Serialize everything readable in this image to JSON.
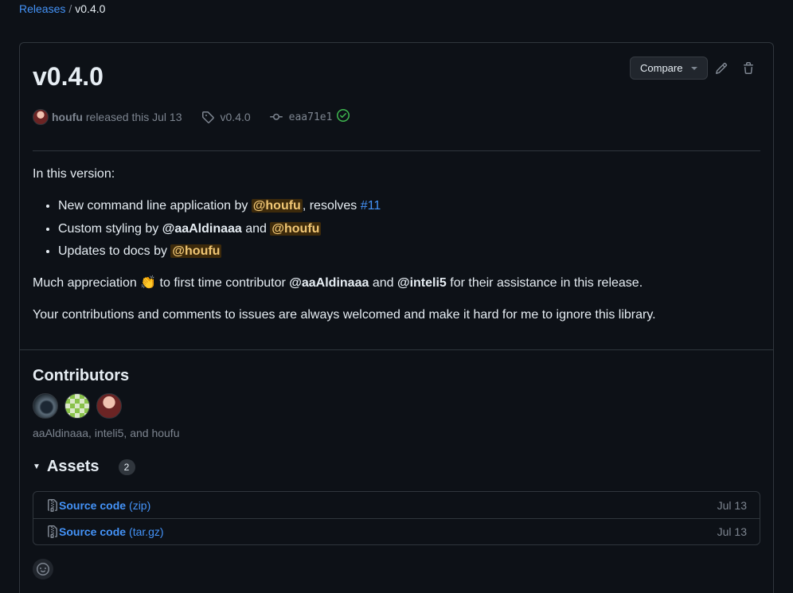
{
  "breadcrumb": {
    "root": "Releases",
    "separator": "/",
    "current": "v0.4.0"
  },
  "release": {
    "title": "v0.4.0",
    "compare_label": "Compare",
    "author": "houfu",
    "released_text": "released this Jul 13",
    "tag": "v0.4.0",
    "commit": "eaa71e1"
  },
  "notes": {
    "intro": "In this version:",
    "items": [
      {
        "text": "New command line application by ",
        "mention": "@houfu",
        "mid": ", resolves ",
        "issue": "#11"
      },
      {
        "text": "Custom styling by ",
        "mention": "@aaAldinaaa",
        "mid": " and ",
        "mention2": "@houfu"
      },
      {
        "text": "Updates to docs by ",
        "mention": "@houfu"
      }
    ],
    "appreciation": {
      "lead": "Much appreciation ",
      "emoji": "👏",
      "mid": " to first time contributor ",
      "m1": "@aaAldinaaa",
      "and": " and ",
      "m2": "@inteli5",
      "tail": " for their assistance in this release."
    },
    "closing": "Your contributions and comments to issues are always welcomed and make it hard for me to ignore this library."
  },
  "contributors": {
    "title": "Contributors",
    "names": "aaAldinaaa, inteli5, and houfu"
  },
  "assets": {
    "title": "Assets",
    "count": "2",
    "items": [
      {
        "name": "Source code",
        "ext": "(zip)",
        "date": "Jul 13"
      },
      {
        "name": "Source code",
        "ext": "(tar.gz)",
        "date": "Jul 13"
      }
    ]
  },
  "colors": {
    "accent": "#4493f8",
    "success": "#3fb950",
    "mention_bg": "#3d2a0b",
    "mention_fg": "#f0c674"
  }
}
